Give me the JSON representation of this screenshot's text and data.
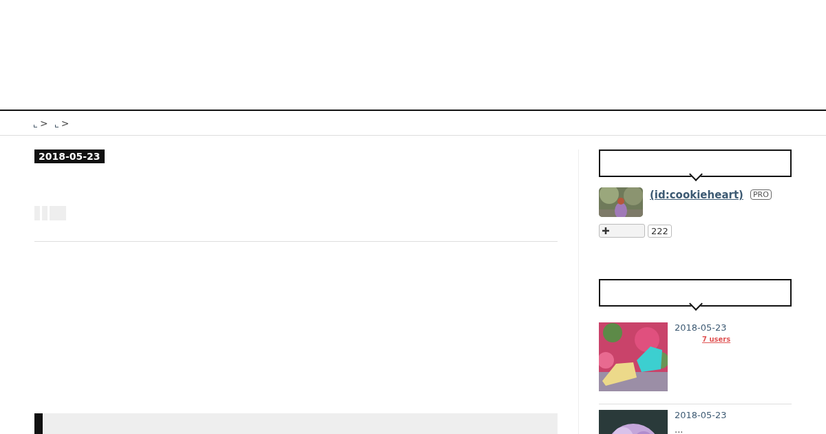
{
  "breadcrumb": [
    {
      "separator": ">"
    },
    {
      "separator": ">"
    }
  ],
  "article": {
    "date": "2018-05-23",
    "share_buttons": [
      {
        "kind": "narrow"
      },
      {
        "kind": "narrow"
      },
      {
        "kind": "wide"
      }
    ]
  },
  "sidebar": {
    "profile": {
      "name": " (id:cookieheart)",
      "badge": "PRO",
      "follow_count": "222"
    },
    "entries": [
      {
        "date": "2018-05-23",
        "bookmarks": "7 users"
      },
      {
        "date": "2018-05-23",
        "excerpt": "..."
      }
    ]
  }
}
